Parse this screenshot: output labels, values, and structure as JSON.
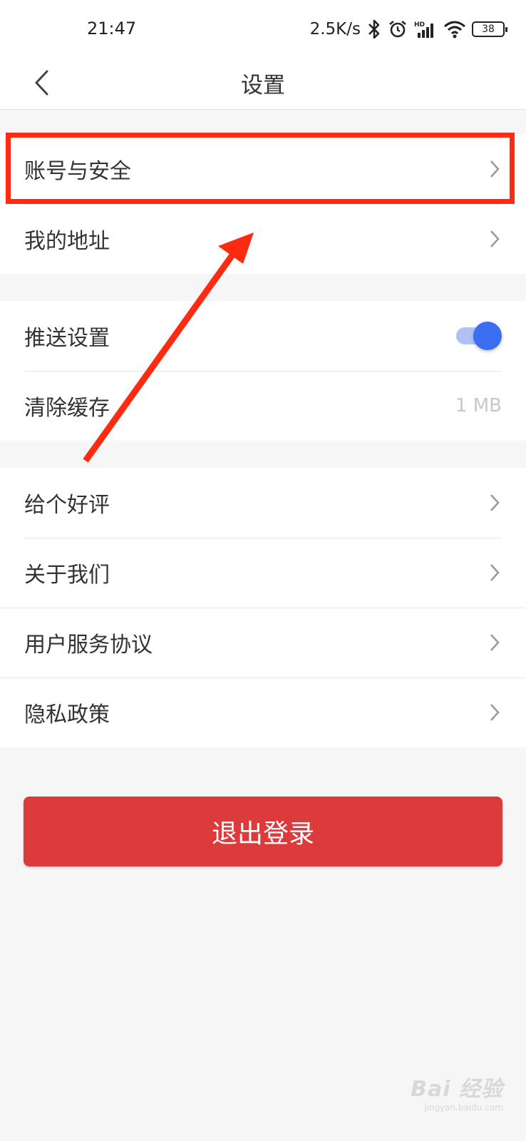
{
  "status_bar": {
    "time": "21:47",
    "net_speed": "2.5K/s",
    "battery": "38",
    "icons": [
      "bluetooth-icon",
      "alarm-icon",
      "hd-signal-icon",
      "wifi-icon",
      "battery-icon"
    ]
  },
  "header": {
    "title": "设置",
    "back_icon": "back-chevron-icon"
  },
  "groups": {
    "account": {
      "items": [
        {
          "label": "账号与安全"
        },
        {
          "label": "我的地址"
        }
      ]
    },
    "preferences": {
      "push_label": "推送设置",
      "push_enabled": true,
      "cache_label": "清除缓存",
      "cache_value": "1 MB"
    },
    "about": {
      "items": [
        {
          "label": "给个好评"
        },
        {
          "label": "关于我们"
        },
        {
          "label": "用户服务协议"
        },
        {
          "label": "隐私政策"
        }
      ]
    }
  },
  "logout": {
    "label": "退出登录"
  },
  "watermark": {
    "logo": "Bai 经验",
    "url": "jingyan.baidu.com"
  },
  "colors": {
    "accent_red": "#dd3a3b",
    "toggle_blue": "#3b6ef0",
    "annotation_red": "#ff2a12"
  }
}
